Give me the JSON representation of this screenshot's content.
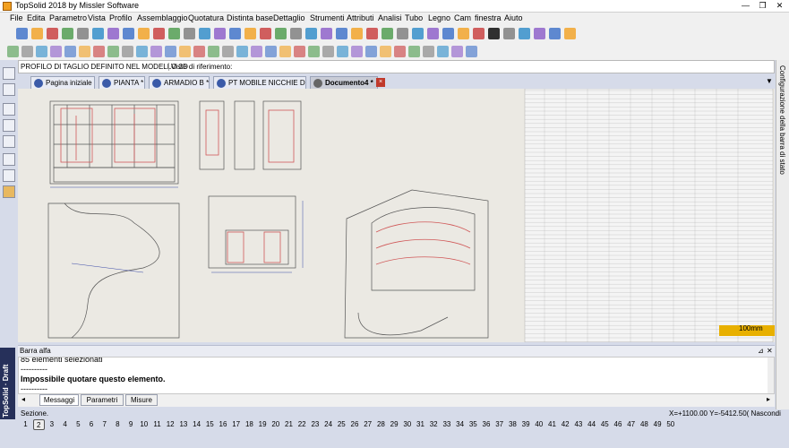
{
  "titlebar": {
    "title": "TopSolid 2018 by Missler Software",
    "minimize": "—",
    "maximize": "❐",
    "close": "✕"
  },
  "menubar": [
    "File",
    "Edita",
    "Parametro",
    "Vista",
    "Profilo",
    "Assemblaggio",
    "Quotatura",
    "Distinta base",
    "Dettaglio",
    "Strumenti",
    "Attributi",
    "Analisi",
    "Tubo",
    "Legno",
    "Cam",
    "finestra",
    "Aiuto"
  ],
  "profilebar": {
    "label": "PROFILO DI TAGLIO DEFINITO NEL MODELLO 3D",
    "views_label": "Viste di riferimento:",
    "views_value": ""
  },
  "tabs": [
    {
      "label": "Pagina iniziale"
    },
    {
      "label": "PIANTA *"
    },
    {
      "label": "ARMADIO B *"
    },
    {
      "label": "PT MOBILE NICCHIE DEF"
    },
    {
      "label": "Documento4 *"
    }
  ],
  "tabs_scroll": "▼",
  "rightbar": {
    "label": "Configurazione della barra di stato"
  },
  "drawing": {
    "scale_label": "100mm",
    "scale_color": "#e8b000"
  },
  "alpha_bar": {
    "title": "Barra alfa",
    "pin": "⊿",
    "close": "✕"
  },
  "messages": [
    {
      "text": "85 elementi selezionati"
    },
    {
      "text": "----------"
    },
    {
      "text": "Impossibile quotare questo elemento."
    },
    {
      "text": "----------"
    }
  ],
  "message_tabs": [
    "Messaggi",
    "Parametri",
    "Misure"
  ],
  "status": {
    "left": "Sezione.",
    "coords": "X=+1100.00  Y=-5412.50( Nascondi"
  },
  "brand": {
    "name": "TopSolid",
    "sub": "Draft"
  },
  "pages": {
    "current": "2",
    "numbers": [
      "1",
      "2",
      "3",
      "4",
      "5",
      "6",
      "7",
      "8",
      "9",
      "10",
      "11",
      "12",
      "13",
      "14",
      "15",
      "16",
      "17",
      "18",
      "19",
      "20",
      "21",
      "22",
      "23",
      "24",
      "25",
      "26",
      "27",
      "28",
      "29",
      "30",
      "31",
      "32",
      "33",
      "34",
      "35",
      "36",
      "37",
      "38",
      "39",
      "40",
      "41",
      "42",
      "43",
      "44",
      "45",
      "46",
      "47",
      "48",
      "49",
      "50"
    ]
  },
  "colors": {
    "ui_blue": "#d6dbe9",
    "accent": "#26305a",
    "close_tab": "#c0392b",
    "drawing_bg": "#ebe9e3"
  }
}
